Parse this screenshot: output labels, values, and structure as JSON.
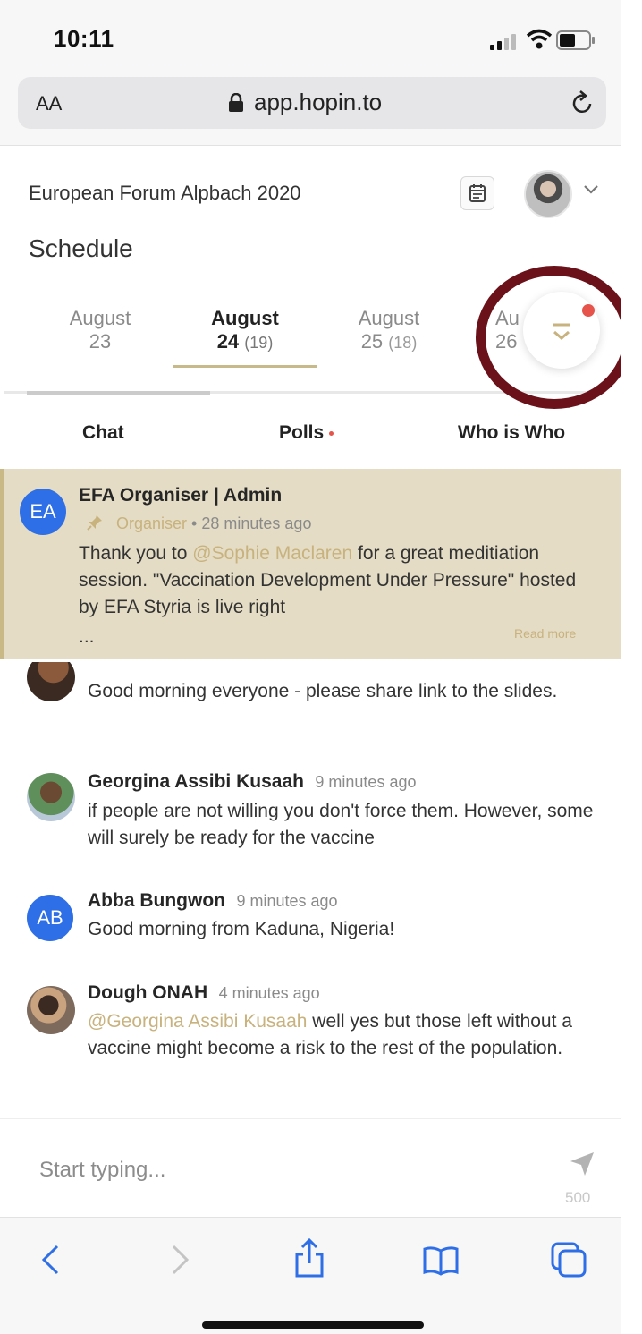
{
  "status": {
    "time": "10:11"
  },
  "browser": {
    "text_size": "AA",
    "url": "app.hopin.to"
  },
  "header": {
    "event_title": "European Forum Alpbach 2020"
  },
  "schedule": {
    "title": "Schedule",
    "days": [
      {
        "month": "August",
        "day": "23",
        "count": ""
      },
      {
        "month": "August",
        "day": "24",
        "count": "(19)",
        "active": true
      },
      {
        "month": "August",
        "day": "25",
        "count": "(18)"
      },
      {
        "month": "Au",
        "day": "26",
        "count": ""
      }
    ]
  },
  "tabs": {
    "chat": "Chat",
    "polls": "Polls",
    "who": "Who is Who"
  },
  "pinned": {
    "avatar": "EA",
    "author": "EFA Organiser | Admin",
    "role": "Organiser",
    "separator": "•",
    "time": "28 minutes ago",
    "text_before": "Thank you to ",
    "mention": "@Sophie Maclaren",
    "text_after": " for a great meditiation session. \"Vaccination Development Under Pressure\" hosted by EFA Styria is live right",
    "ellipsis": "...",
    "read_more": "Read more"
  },
  "messages": [
    {
      "text": "Good morning everyone - please share link to the slides."
    },
    {
      "author": "Georgina Assibi Kusaah",
      "time": "9 minutes ago",
      "text": "if people are not willing you don't force them. However, some will surely be ready for the vaccine"
    },
    {
      "avatar": "AB",
      "author": "Abba Bungwon",
      "time": "9 minutes ago",
      "text": "Good morning from Kaduna, Nigeria!"
    },
    {
      "author": "Dough ONAH",
      "time": "4 minutes ago",
      "mention": "@Georgina Assibi Kusaah",
      "text": " well yes but those left without a vaccine might become a risk to the rest of the population."
    }
  ],
  "composer": {
    "placeholder": "Start typing...",
    "char_limit": "500"
  },
  "colors": {
    "accent": "#c8b27e",
    "pinned_bg": "#e4dcc4",
    "avatar_blue": "#2e6ee6",
    "notify": "#e5534b",
    "annotation": "#6a1119"
  }
}
